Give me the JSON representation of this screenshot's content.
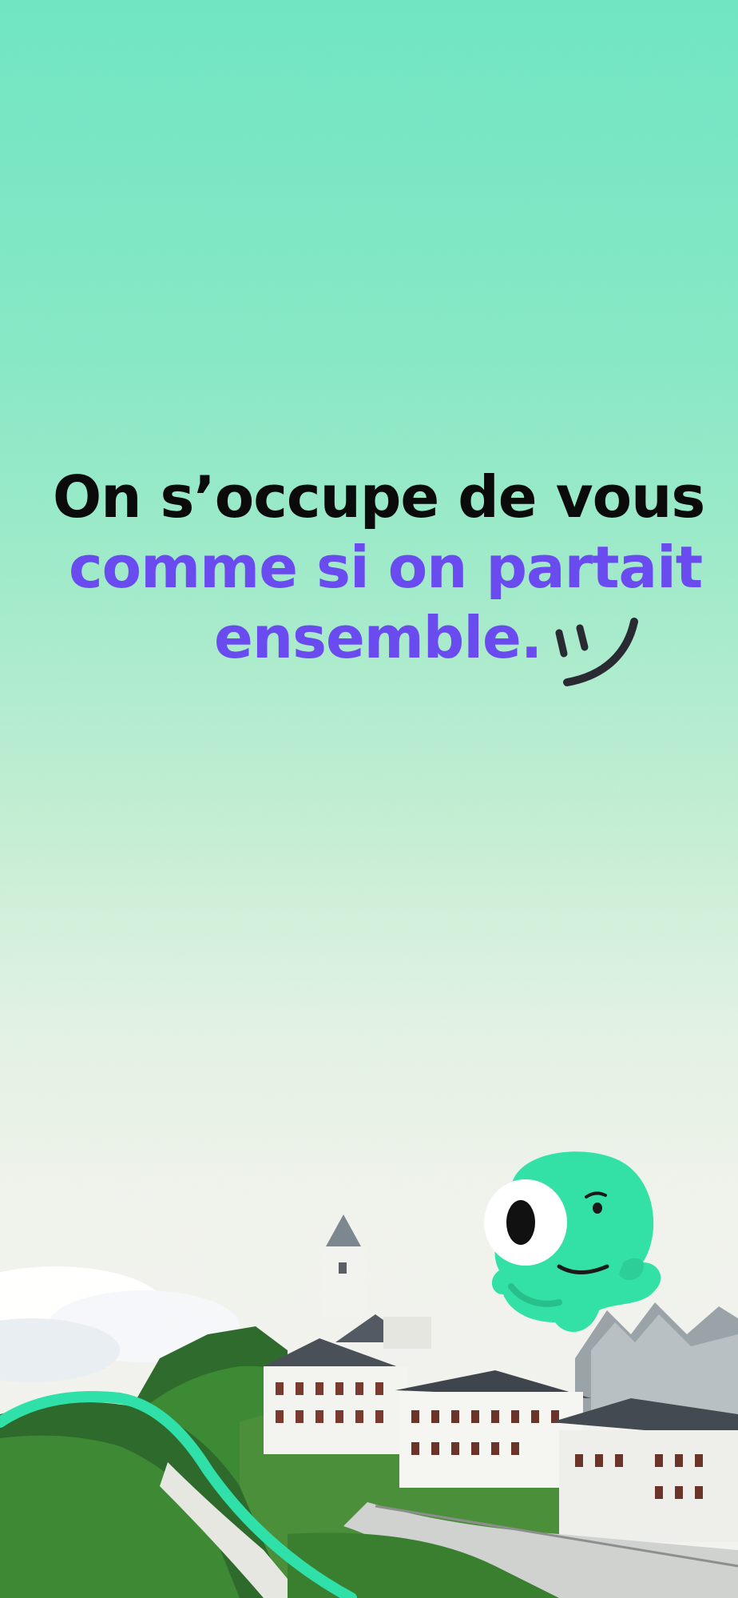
{
  "headline": {
    "line1": "On s’occupe de vous",
    "line2": "comme si on partait",
    "line3": "ensemble."
  },
  "colors": {
    "headline_dark": "#0b0b0b",
    "headline_accent": "#6a4bf0",
    "brand_green": "#2fe0a8"
  },
  "icons": {
    "smiley": "wink-smiley-icon",
    "mascot": "green-eyeball-mascot"
  }
}
